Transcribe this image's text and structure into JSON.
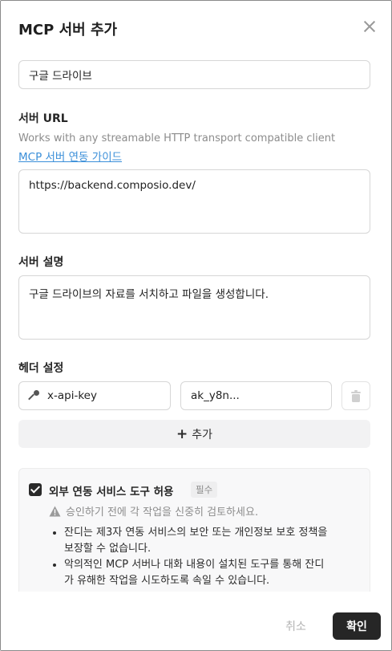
{
  "dialog": {
    "title": "MCP 서버 추가",
    "close_icon": "close-icon"
  },
  "name_field": {
    "value": "구글 드라이브"
  },
  "server_url": {
    "label": "서버 URL",
    "hint": "Works with any streamable HTTP transport compatible client",
    "guide_link": "MCP 서버 연동 가이드",
    "value": "https://backend.composio.dev/"
  },
  "description": {
    "label": "서버 설명",
    "value": "구글 드라이브의 자료를 서치하고 파일을 생성합니다."
  },
  "headers": {
    "label": "헤더 설정",
    "rows": [
      {
        "key": "x-api-key",
        "value": "ak_y8n...",
        "key_icon": "key-icon",
        "delete_icon": "trash-icon"
      }
    ],
    "add_label": "추가",
    "add_icon": "plus-icon"
  },
  "consent": {
    "checked": true,
    "title": "외부 연동 서비스 도구 허용",
    "required_badge": "필수",
    "warning": "승인하기 전에 각 작업을 신중히 검토하세요.",
    "bullets": [
      "잔디는 제3자 연동 서비스의 보안 또는 개인정보 보호 정책을 보장할 수 없습니다.",
      "악의적인 MCP 서버나 대화 내용이 설치된 도구를 통해 잔디가 유해한 작업을 시도하도록 속일 수 있습니다."
    ]
  },
  "footer": {
    "cancel_label": "취소",
    "confirm_label": "확인"
  },
  "colors": {
    "primary_button": "#262626",
    "link": "#3b8fd9",
    "muted_text": "#8c8c8c"
  }
}
